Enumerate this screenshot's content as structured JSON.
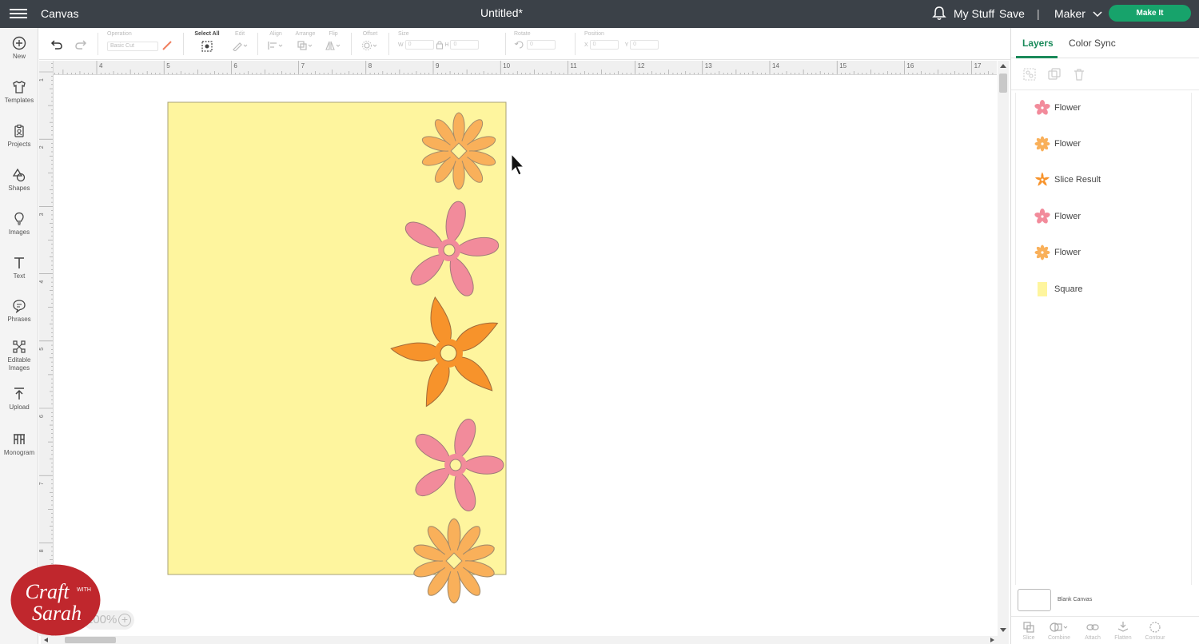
{
  "topbar": {
    "app_title": "Canvas",
    "document_title": "Untitled*",
    "my_stuff": "My Stuff",
    "save": "Save",
    "divider": "|",
    "machine": "Maker",
    "make_it": "Make It"
  },
  "sidebar": {
    "items": [
      {
        "label": "New",
        "icon": "plus-circle-icon"
      },
      {
        "label": "Templates",
        "icon": "shirt-icon"
      },
      {
        "label": "Projects",
        "icon": "clipboard-icon"
      },
      {
        "label": "Shapes",
        "icon": "shapes-icon"
      },
      {
        "label": "Images",
        "icon": "lightbulb-icon"
      },
      {
        "label": "Text",
        "icon": "text-icon"
      },
      {
        "label": "Phrases",
        "icon": "speech-bubble-icon"
      },
      {
        "label": "Editable Images",
        "icon": "editable-image-icon"
      },
      {
        "label": "Upload",
        "icon": "upload-icon"
      },
      {
        "label": "Monogram",
        "icon": "monogram-icon"
      }
    ]
  },
  "toolbar": {
    "operation_label": "Operation",
    "operation_value": "Basic Cut",
    "select_all": "Select All",
    "edit": "Edit",
    "align": "Align",
    "arrange": "Arrange",
    "flip": "Flip",
    "offset": "Offset",
    "size": "Size",
    "w": "W",
    "h": "H",
    "rotate": "Rotate",
    "position": "Position",
    "x": "X",
    "y": "Y",
    "field_value": "0"
  },
  "rulers": {
    "top": [
      "4",
      "5",
      "6",
      "7",
      "8",
      "9",
      "10",
      "11",
      "12",
      "13",
      "14",
      "15",
      "16",
      "17"
    ],
    "left": [
      "1",
      "2",
      "3",
      "4",
      "5",
      "6",
      "7",
      "8"
    ]
  },
  "zoom": {
    "value": "100%"
  },
  "logo": {
    "line1": "Craft",
    "line2": "WITH",
    "line3": "Sarah"
  },
  "panel": {
    "tab_layers": "Layers",
    "tab_color_sync": "Color Sync",
    "layers": [
      {
        "name": "Flower",
        "color": "#f28b9b",
        "shape": "flower-petal"
      },
      {
        "name": "Flower",
        "color": "#f9b05a",
        "shape": "flower-daisy"
      },
      {
        "name": "Slice Result",
        "color": "#f7932b",
        "shape": "flower-star"
      },
      {
        "name": "Flower",
        "color": "#f28b9b",
        "shape": "flower-petal"
      },
      {
        "name": "Flower",
        "color": "#f9b05a",
        "shape": "flower-daisy"
      },
      {
        "name": "Square",
        "color": "#fef59e",
        "shape": "square"
      }
    ],
    "blank_canvas": "Blank Canvas",
    "bottom_tools": [
      "Slice",
      "Combine",
      "Attach",
      "Flatten",
      "Contour"
    ]
  },
  "colors": {
    "topbar": "#3b4148",
    "make_it": "#17a36b",
    "card": "#fef59e",
    "pink": "#f28b9b",
    "light_orange": "#f9b05a",
    "orange": "#f7932b",
    "accent": "#1a8a5a"
  }
}
